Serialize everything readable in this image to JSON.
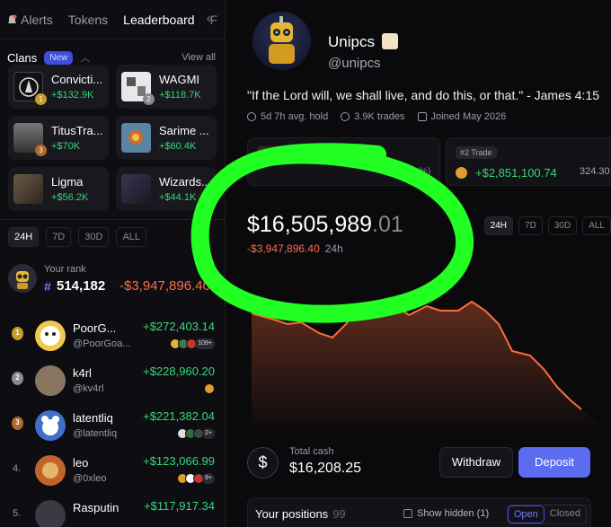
{
  "nav": {
    "tabs": [
      "Alerts",
      "Tokens",
      "Leaderboard",
      "F"
    ],
    "active_tab": "Leaderboard"
  },
  "clans": {
    "title": "Clans",
    "badge": "New",
    "view_all": "View all",
    "items": [
      {
        "name": "Convicti...",
        "value": "+$132.9K",
        "rank": "1"
      },
      {
        "name": "WAGMI",
        "value": "+$118.7K",
        "rank": "2"
      },
      {
        "name": "TitusTra...",
        "value": "+$70K",
        "rank": "3"
      },
      {
        "name": "Sarime ...",
        "value": "+$60.4K",
        "rank": ""
      },
      {
        "name": "Ligma",
        "value": "+$56.2K",
        "rank": ""
      },
      {
        "name": "Wizards...",
        "value": "+$44.1K",
        "rank": ""
      }
    ]
  },
  "ranges": [
    "24H",
    "7D",
    "30D",
    "ALL"
  ],
  "your_rank": {
    "label": "Your rank",
    "hash": "#",
    "rank": "514,182",
    "pnl": "-$3,947,896.40"
  },
  "leaderboard": [
    {
      "pos": "1",
      "name": "PoorG...",
      "handle": "@PoorGoa...",
      "gain": "+$272,403.14",
      "more": "109+"
    },
    {
      "pos": "2",
      "name": "k4rl",
      "handle": "@kv4rl",
      "gain": "+$228,960.20",
      "more": ""
    },
    {
      "pos": "3",
      "name": "latentliq",
      "handle": "@latentliq",
      "gain": "+$221,382.04",
      "more": "2+"
    },
    {
      "pos": "4.",
      "name": "leo",
      "handle": "@0xleo",
      "gain": "+$123,066.99",
      "more": "9+"
    },
    {
      "pos": "5.",
      "name": "Rasputin",
      "handle": "",
      "gain": "+$117,917.34",
      "more": ""
    }
  ],
  "profile": {
    "name": "Unipcs",
    "handle": "@unipcs",
    "bio": "\"If the Lord will, we shall live, and do this, or that.\" - James 4:15",
    "stats": {
      "hold": "5d 7h avg. hold",
      "trades": "3.9K trades",
      "joined": "Joined May 2026"
    }
  },
  "trades": [
    {
      "badge": "#1 Trade",
      "value": "",
      "pct": "%)"
    },
    {
      "badge": "#2 Trade",
      "value": "+$2,851,100.74",
      "pct": "324.30"
    }
  ],
  "portfolio": {
    "value_main": "$16,505,989",
    "value_dec": ".01",
    "change": "-$3,947,896.40",
    "period": "24h",
    "ranges": [
      "24H",
      "7D",
      "30D",
      "ALL"
    ],
    "active_range": "24H"
  },
  "cash": {
    "label": "Total cash",
    "value": "$16,208.25",
    "symbol": "$"
  },
  "actions": {
    "withdraw": "Withdraw",
    "deposit": "Deposit"
  },
  "positions": {
    "title": "Your positions",
    "count": "99",
    "show_hidden": "Show hidden (1)",
    "open": "Open",
    "closed": "Closed"
  },
  "colors": {
    "positive": "#37d67a",
    "negative": "#ff6b4a",
    "accent": "#5b6cf0",
    "highlight": "#22ff22"
  }
}
